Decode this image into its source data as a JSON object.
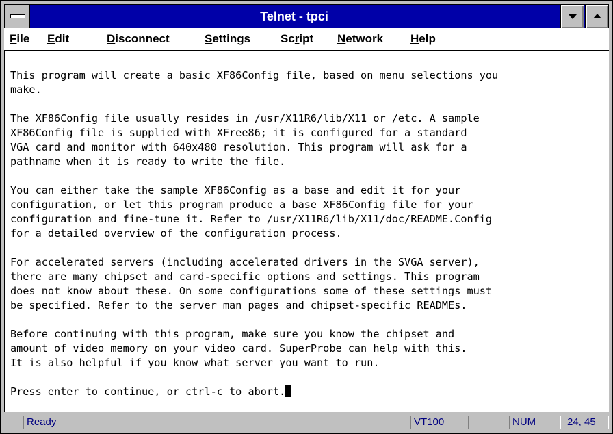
{
  "window": {
    "title": "Telnet - tpci"
  },
  "menu": [
    {
      "pre": "",
      "key": "F",
      "post": "ile"
    },
    {
      "pre": "",
      "key": "E",
      "post": "dit"
    },
    {
      "pre": "",
      "key": "D",
      "post": "isconnect"
    },
    {
      "pre": "",
      "key": "S",
      "post": "ettings"
    },
    {
      "pre": "Sc",
      "key": "r",
      "post": "ipt"
    },
    {
      "pre": "",
      "key": "N",
      "post": "etwork"
    },
    {
      "pre": "",
      "key": "H",
      "post": "elp"
    }
  ],
  "terminal": {
    "lines": [
      "This program will create a basic XF86Config file, based on menu selections you",
      "make.",
      "",
      "The XF86Config file usually resides in /usr/X11R6/lib/X11 or /etc. A sample",
      "XF86Config file is supplied with XFree86; it is configured for a standard",
      "VGA card and monitor with 640x480 resolution. This program will ask for a",
      "pathname when it is ready to write the file.",
      "",
      "You can either take the sample XF86Config as a base and edit it for your",
      "configuration, or let this program produce a base XF86Config file for your",
      "configuration and fine-tune it. Refer to /usr/X11R6/lib/X11/doc/README.Config",
      "for a detailed overview of the configuration process.",
      "",
      "For accelerated servers (including accelerated drivers in the SVGA server),",
      "there are many chipset and card-specific options and settings. This program",
      "does not know about these. On some configurations some of these settings must",
      "be specified. Refer to the server man pages and chipset-specific READMEs.",
      "",
      "Before continuing with this program, make sure you know the chipset and",
      "amount of video memory on your video card. SuperProbe can help with this.",
      "It is also helpful if you know what server you want to run.",
      "",
      "Press enter to continue, or ctrl-c to abort."
    ]
  },
  "status": {
    "ready": "Ready",
    "emulation": "VT100",
    "blank": "",
    "num": "NUM",
    "position": "24, 45"
  }
}
